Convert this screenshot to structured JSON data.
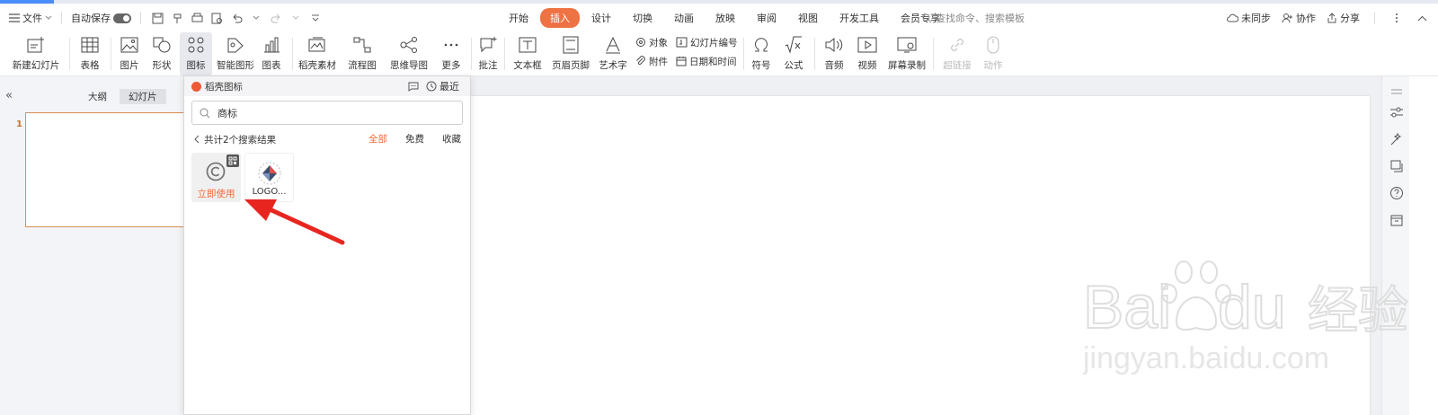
{
  "menubar": {
    "file_menu": "文件",
    "autosave_label": "自动保存",
    "tabs": [
      {
        "label": "开始",
        "active": false
      },
      {
        "label": "插入",
        "active": true
      },
      {
        "label": "设计",
        "active": false
      },
      {
        "label": "切换",
        "active": false
      },
      {
        "label": "动画",
        "active": false
      },
      {
        "label": "放映",
        "active": false
      },
      {
        "label": "审阅",
        "active": false
      },
      {
        "label": "视图",
        "active": false
      },
      {
        "label": "开发工具",
        "active": false
      },
      {
        "label": "会员专享",
        "active": false
      }
    ],
    "search_placeholder": "查找命令、搜索模板",
    "right": {
      "sync": "未同步",
      "collab": "协作",
      "share": "分享"
    }
  },
  "ribbon": {
    "new_slide": "新建幻灯片",
    "table": "表格",
    "picture": "图片",
    "shape": "形状",
    "icon": "图标",
    "smart_art": "智能图形",
    "chart": "图表",
    "shell_material": "稻壳素材",
    "flowchart": "流程图",
    "mindmap": "思维导图",
    "more": "更多",
    "comment": "批注",
    "textbox": "文本框",
    "header_footer": "页眉页脚",
    "wordart": "艺术字",
    "object": "对象",
    "attachment": "附件",
    "slide_number": "幻灯片编号",
    "date_time": "日期和时间",
    "symbol": "符号",
    "formula": "公式",
    "audio": "音频",
    "video": "视频",
    "screen_record": "屏幕录制",
    "hyperlink": "超链接",
    "action": "动作"
  },
  "left_panel": {
    "outline_tab": "大纲",
    "slides_tab": "幻灯片",
    "slide_number": "1"
  },
  "icon_panel": {
    "title": "稻壳图标",
    "recent": "最近",
    "search_value": "商标",
    "results_text": "共计2个搜索结果",
    "filters": [
      {
        "label": "全部",
        "active": true
      },
      {
        "label": "免费",
        "active": false
      },
      {
        "label": "收藏",
        "active": false
      }
    ],
    "items": [
      {
        "label": "立即使用"
      },
      {
        "label": "LOGO..."
      }
    ]
  },
  "watermark": {
    "text1": "Bai",
    "text2": "du",
    "text3": "经验",
    "text4": "jingyan.baidu.com"
  },
  "colors": {
    "accent": "#ee7243",
    "arrow": "#e8251f"
  }
}
